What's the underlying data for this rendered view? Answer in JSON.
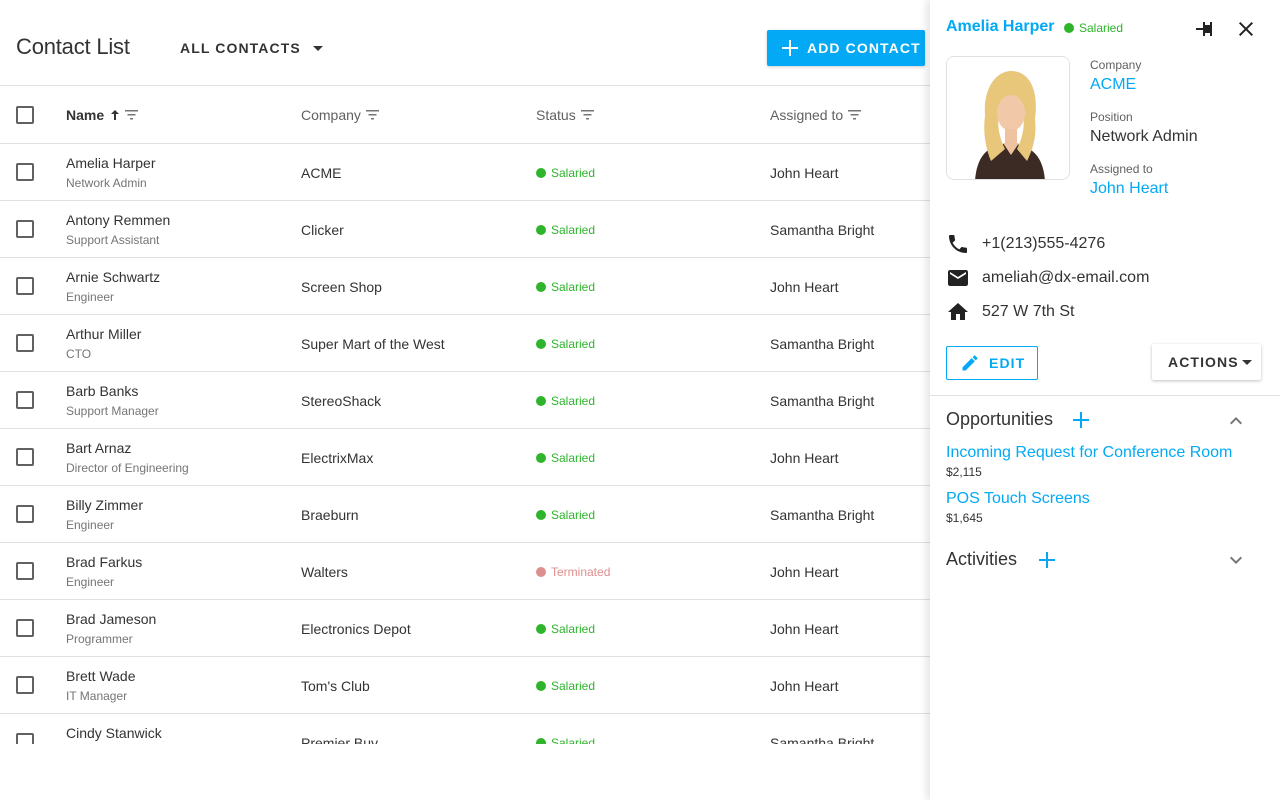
{
  "page": {
    "title": "Contact List",
    "filter_label": "All Contacts",
    "add_label": "Add Contact"
  },
  "columns": {
    "name": "Name",
    "company": "Company",
    "status": "Status",
    "assigned": "Assigned to"
  },
  "colors": {
    "accent": "#03a9f4",
    "salaried": "#2eb52c",
    "terminated": "#de8e8c"
  },
  "contacts": [
    {
      "name": "Amelia Harper",
      "position": "Network Admin",
      "company": "ACME",
      "status": "Salaried",
      "assigned": "John Heart"
    },
    {
      "name": "Antony Remmen",
      "position": "Support Assistant",
      "company": "Clicker",
      "status": "Salaried",
      "assigned": "Samantha Bright"
    },
    {
      "name": "Arnie Schwartz",
      "position": "Engineer",
      "company": "Screen Shop",
      "status": "Salaried",
      "assigned": "John Heart"
    },
    {
      "name": "Arthur Miller",
      "position": "CTO",
      "company": "Super Mart of the West",
      "status": "Salaried",
      "assigned": "Samantha Bright"
    },
    {
      "name": "Barb Banks",
      "position": "Support Manager",
      "company": "StereoShack",
      "status": "Salaried",
      "assigned": "Samantha Bright"
    },
    {
      "name": "Bart Arnaz",
      "position": "Director of Engineering",
      "company": "ElectrixMax",
      "status": "Salaried",
      "assigned": "John Heart"
    },
    {
      "name": "Billy Zimmer",
      "position": "Engineer",
      "company": "Braeburn",
      "status": "Salaried",
      "assigned": "Samantha Bright"
    },
    {
      "name": "Brad Farkus",
      "position": "Engineer",
      "company": "Walters",
      "status": "Terminated",
      "assigned": "John Heart"
    },
    {
      "name": "Brad Jameson",
      "position": "Programmer",
      "company": "Electronics Depot",
      "status": "Salaried",
      "assigned": "John Heart"
    },
    {
      "name": "Brett Wade",
      "position": "IT Manager",
      "company": "Tom's Club",
      "status": "Salaried",
      "assigned": "John Heart"
    },
    {
      "name": "Cindy Stanwick",
      "position": "",
      "company": "Premier Buy",
      "status": "Salaried",
      "assigned": "Samantha Bright"
    }
  ],
  "panel": {
    "name": "Amelia Harper",
    "status": "Salaried",
    "company_label": "Company",
    "company": "ACME",
    "position_label": "Position",
    "position": "Network Admin",
    "assigned_label": "Assigned to",
    "assigned": "John Heart",
    "phone": "+1(213)555-4276",
    "email": "ameliah@dx-email.com",
    "address": "527 W 7th St",
    "edit_label": "Edit",
    "actions_label": "Actions",
    "opportunities_title": "Opportunities",
    "opportunities": [
      {
        "name": "Incoming Request for Conference Room",
        "amount": "$2,115"
      },
      {
        "name": "POS Touch Screens",
        "amount": "$1,645"
      }
    ],
    "activities_title": "Activities"
  }
}
